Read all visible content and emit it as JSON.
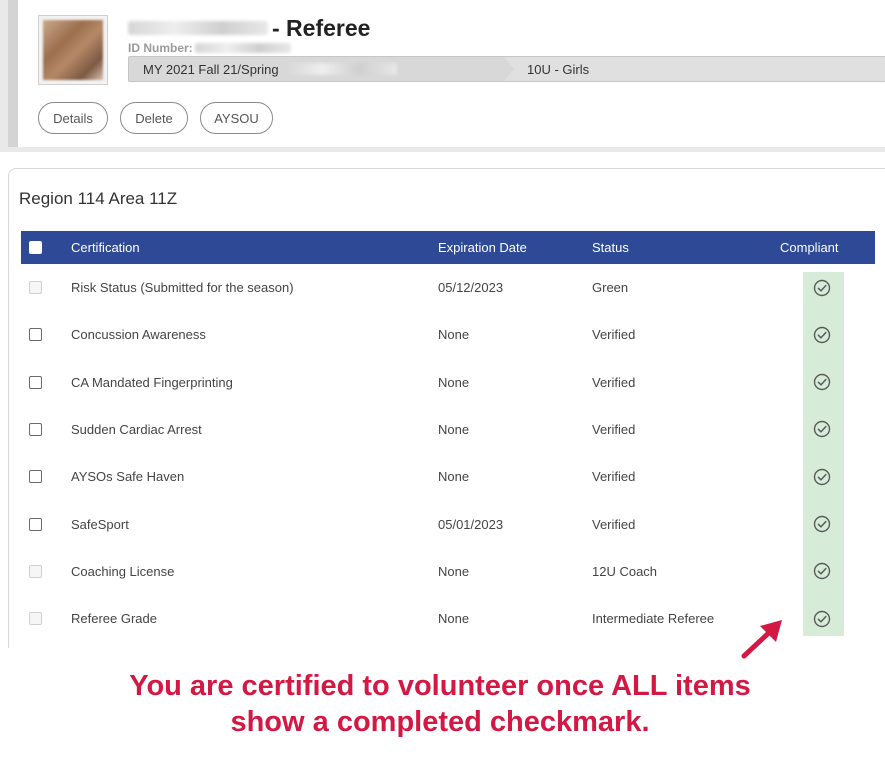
{
  "header": {
    "role": "- Referee",
    "id_label": "ID Number:",
    "breadcrumb": {
      "program": "MY 2021 Fall 21/Spring",
      "division": "10U - Girls"
    },
    "buttons": {
      "details": "Details",
      "delete": "Delete",
      "aysou": "AYSOU"
    }
  },
  "region": {
    "title": "Region 114 Area 11Z"
  },
  "table": {
    "headers": {
      "certification": "Certification",
      "expiration": "Expiration Date",
      "status": "Status",
      "compliant": "Compliant"
    },
    "rows": [
      {
        "certification": "Risk Status (Submitted for the season)",
        "expiration": "05/12/2023",
        "status": "Green",
        "checkbox_enabled": false,
        "compliant": true
      },
      {
        "certification": "Concussion Awareness",
        "expiration": "None",
        "status": "Verified",
        "checkbox_enabled": true,
        "compliant": true
      },
      {
        "certification": "CA Mandated Fingerprinting",
        "expiration": "None",
        "status": "Verified",
        "checkbox_enabled": true,
        "compliant": true
      },
      {
        "certification": "Sudden Cardiac Arrest",
        "expiration": "None",
        "status": "Verified",
        "checkbox_enabled": true,
        "compliant": true
      },
      {
        "certification": "AYSOs Safe Haven",
        "expiration": "None",
        "status": "Verified",
        "checkbox_enabled": true,
        "compliant": true
      },
      {
        "certification": "SafeSport",
        "expiration": "05/01/2023",
        "status": "Verified",
        "checkbox_enabled": true,
        "compliant": true
      },
      {
        "certification": "Coaching License",
        "expiration": "None",
        "status": "12U Coach",
        "checkbox_enabled": false,
        "compliant": true
      },
      {
        "certification": "Referee Grade",
        "expiration": "None",
        "status": "Intermediate Referee",
        "checkbox_enabled": false,
        "compliant": true
      }
    ]
  },
  "callout": {
    "line1": "You are certified to volunteer once ALL items",
    "line2": "show a completed checkmark."
  },
  "colors": {
    "table_header": "#2e4a96",
    "compliant_bg": "#d7ecd8",
    "check_icon": "#5a5a5a",
    "callout": "#d41844"
  },
  "icons": {
    "compliant": "check-circle-icon",
    "arrow": "arrow-up-right-icon"
  }
}
